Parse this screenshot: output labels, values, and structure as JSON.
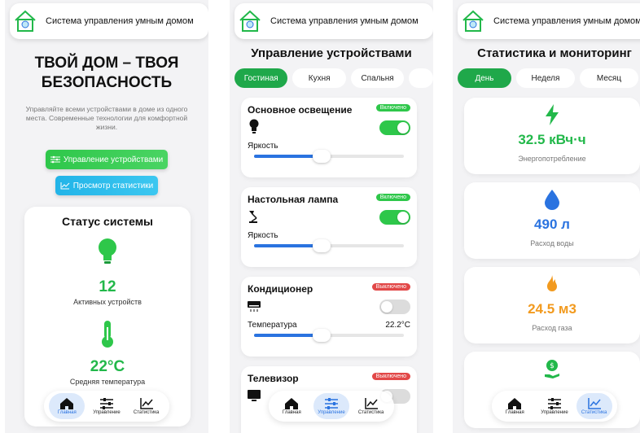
{
  "app_title": "Система управления умным домом",
  "colors": {
    "green": "#22b84a",
    "blue": "#2a73e0",
    "orange": "#f29a1e",
    "red": "#e24848"
  },
  "home": {
    "hero_title": "ТВОЙ ДОМ – ТВОЯ БЕЗОПАСНОСТЬ",
    "hero_desc": "Управляйте всеми устройствами в доме из одного места. Современные технологии для комфортной жизни.",
    "btn_devices": "Управление устройствами",
    "btn_stats": "Просмотр статистики",
    "status": {
      "title": "Статус системы",
      "active_count": "12",
      "active_label": "Активных устройств",
      "temp_value": "22°C",
      "temp_label": "Средняя температура"
    }
  },
  "nav": {
    "home": "Главная",
    "control": "Управление",
    "stats": "Статистика"
  },
  "devices": {
    "title": "Управление устройствами",
    "tabs": [
      "Гостиная",
      "Кухня",
      "Спальня"
    ],
    "items": [
      {
        "name": "Основное освещение",
        "status": "Включено",
        "control_label": "Яркость",
        "value": "",
        "level": 0.45,
        "on": true,
        "icon": "lightbulb-icon"
      },
      {
        "name": "Настольная лампа",
        "status": "Включено",
        "control_label": "Яркость",
        "value": "",
        "level": 0.45,
        "on": true,
        "icon": "desk-lamp-icon"
      },
      {
        "name": "Кондиционер",
        "status": "Выключено",
        "control_label": "Температура",
        "value": "22.2°C",
        "level": 0.45,
        "on": false,
        "icon": "air-conditioner-icon"
      },
      {
        "name": "Телевизор",
        "status": "Выключено",
        "on": false,
        "icon": "tv-icon"
      }
    ]
  },
  "stats": {
    "title": "Статистика и мониторинг",
    "tabs": [
      "День",
      "Неделя",
      "Месяц"
    ],
    "cards": [
      {
        "value": "32.5 кВч·ч",
        "label": "Энергопотребление",
        "color": "#22b84a",
        "icon": "lightning-icon"
      },
      {
        "value": "490 л",
        "label": "Расход воды",
        "color": "#2a73e0",
        "icon": "water-drop-icon"
      },
      {
        "value": "24.5 м3",
        "label": "Расход газа",
        "color": "#f29a1e",
        "icon": "flame-icon"
      }
    ]
  }
}
